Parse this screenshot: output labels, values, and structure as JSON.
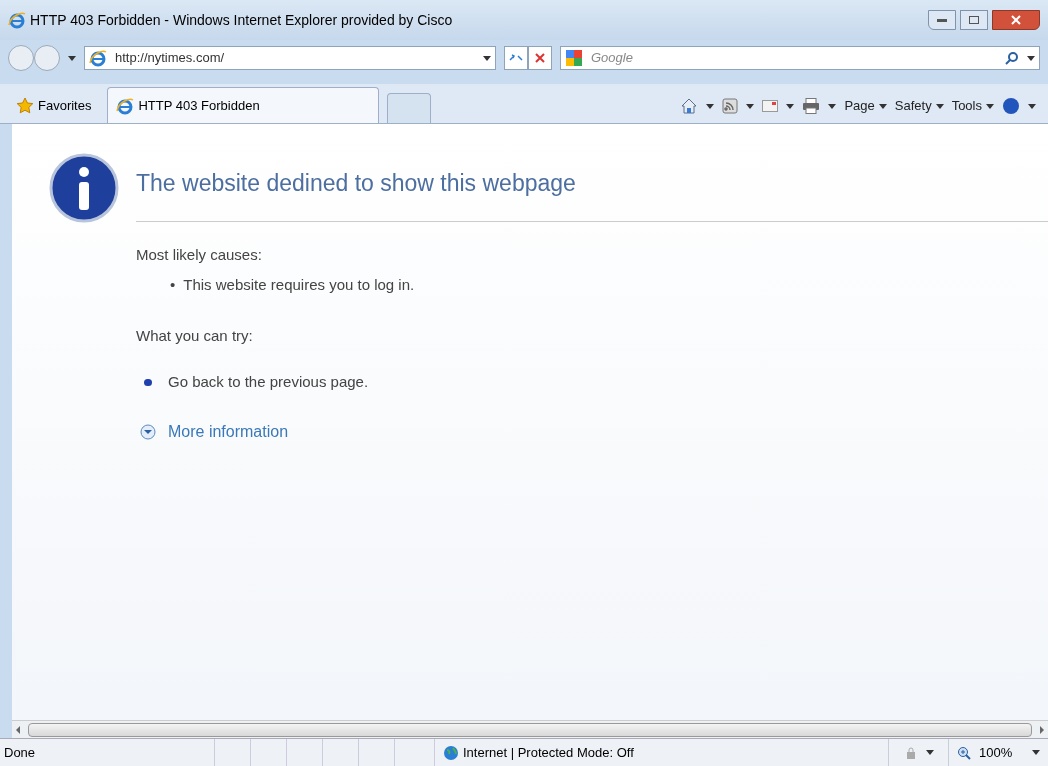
{
  "window": {
    "title": "HTTP 403 Forbidden - Windows Internet Explorer provided by Cisco"
  },
  "address_bar": {
    "value": "http://nytimes.com/"
  },
  "search": {
    "placeholder": "Google"
  },
  "tabs": [
    {
      "label": "HTTP 403 Forbidden",
      "selected": true
    }
  ],
  "favorites": {
    "label": "Favorites"
  },
  "command_bar": [
    {
      "kind": "home"
    },
    {
      "kind": "feed"
    },
    {
      "kind": "mail"
    },
    {
      "kind": "print"
    },
    {
      "kind": "menu",
      "label": "Page"
    },
    {
      "kind": "menu",
      "label": "Safety"
    },
    {
      "kind": "menu",
      "label": "Tools"
    },
    {
      "kind": "help"
    }
  ],
  "page": {
    "heading": "The website dedined to show this webpage",
    "causes_title": "Most likely causes:",
    "causes": [
      {
        "bullet": "•",
        "text": "This website requires you to log in."
      }
    ],
    "try_title": "What you can try:",
    "try_items": [
      "Go back to the previous page."
    ],
    "more_info": {
      "label": "More information",
      "expanded": false
    }
  },
  "status_bar": {
    "status": "Done",
    "zone": "Internet | Protected Mode: Off",
    "zoom": "100%"
  }
}
